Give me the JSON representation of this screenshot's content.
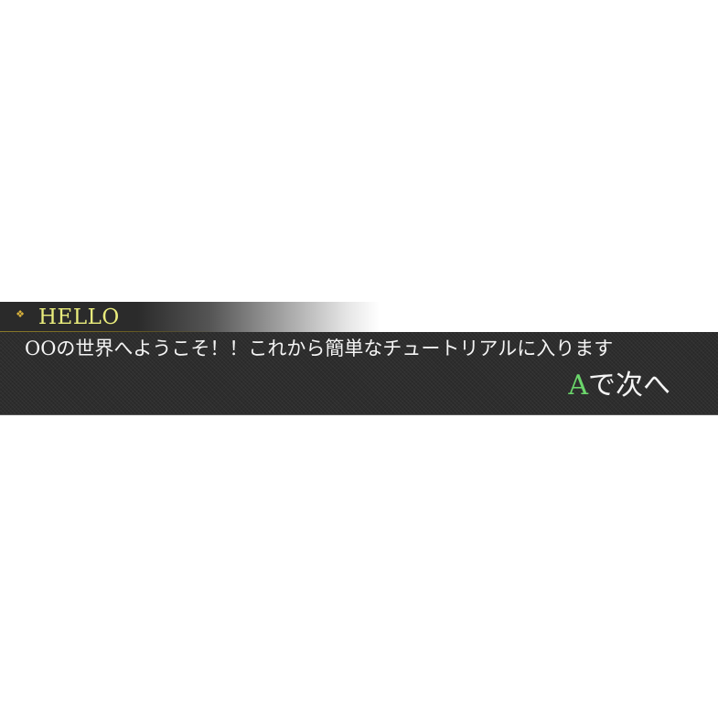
{
  "dialog": {
    "speaker_icon": "diamond-icon",
    "speaker_name": "HELLO",
    "message": "OOの世界へようこそ！！これから簡単なチュートリアルに入ります",
    "next_prompt": {
      "key": "A",
      "label": "で次へ"
    }
  },
  "colors": {
    "speaker_name": "#e9ec7c",
    "speaker_icon": "#d9b23c",
    "message_text": "#f4f4f4",
    "next_key": "#6bd66b",
    "box_background": "#2d2d2d"
  }
}
